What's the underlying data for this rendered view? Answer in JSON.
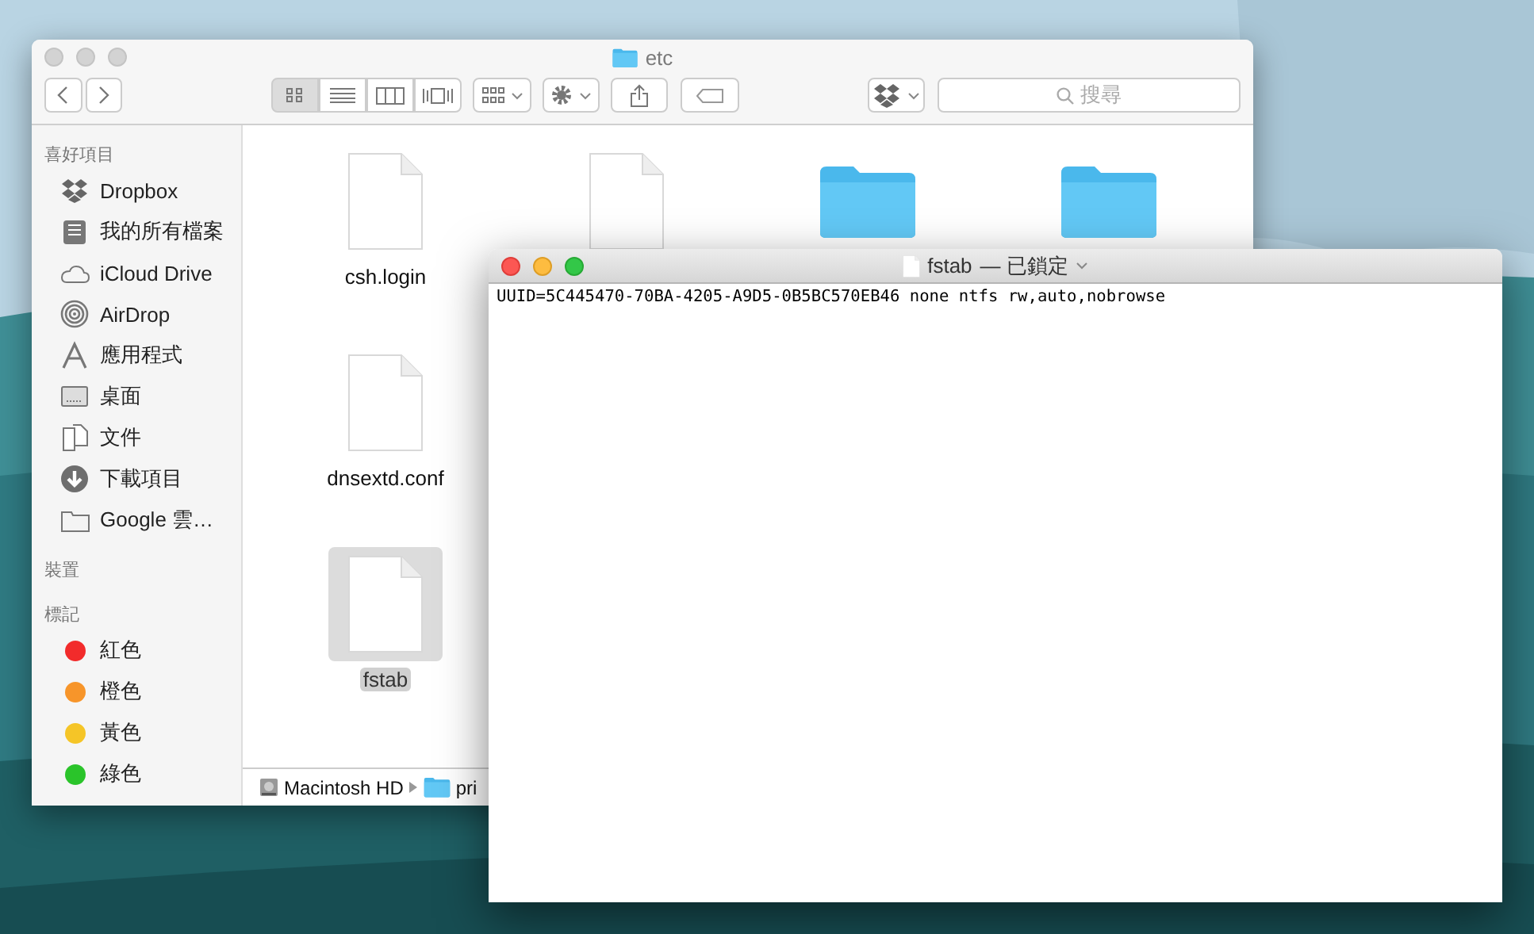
{
  "finder": {
    "title": "etc",
    "view_modes": [
      {
        "selected": true
      },
      {
        "selected": false
      },
      {
        "selected": false
      },
      {
        "selected": false
      }
    ],
    "search": {
      "placeholder": "搜尋"
    },
    "sidebar": [
      {
        "heading": "喜好項目",
        "items": [
          {
            "kind": "dropbox",
            "label": "Dropbox"
          },
          {
            "kind": "files",
            "label": "我的所有檔案"
          },
          {
            "kind": "cloud",
            "label": "iCloud Drive"
          },
          {
            "kind": "airdrop",
            "label": "AirDrop"
          },
          {
            "kind": "apps",
            "label": "應用程式"
          },
          {
            "kind": "desktop",
            "label": "桌面"
          },
          {
            "kind": "documents",
            "label": "文件"
          },
          {
            "kind": "downloads",
            "label": "下載項目"
          },
          {
            "kind": "folder",
            "label": "Google 雲…"
          }
        ]
      },
      {
        "heading": "裝置"
      },
      {
        "heading": "標記",
        "items": [
          {
            "kind": "tag",
            "label": "紅色",
            "color": "#f22b2b"
          },
          {
            "kind": "tag",
            "label": "橙色",
            "color": "#f7952a"
          },
          {
            "kind": "tag",
            "label": "黃色",
            "color": "#f5c527"
          },
          {
            "kind": "tag",
            "label": "綠色",
            "color": "#2ac42a"
          }
        ]
      }
    ],
    "files": [
      {
        "kind": "document",
        "label": "csh.login",
        "selected": false
      },
      {
        "kind": "document"
      },
      {
        "kind": "folder"
      },
      {
        "kind": "folder"
      },
      {
        "kind": "document",
        "label": "dnsextd.conf",
        "selected": false
      },
      {
        "kind": "blank"
      },
      {
        "kind": "blank"
      },
      {
        "kind": "blank"
      },
      {
        "kind": "document",
        "label": "fstab",
        "selected": true
      }
    ],
    "path_bar": [
      {
        "kind": "disk",
        "label": "Macintosh HD"
      },
      {
        "kind": "folder",
        "label": "pri"
      }
    ]
  },
  "editor": {
    "title": "fstab",
    "status": "— 已鎖定",
    "text": "UUID=5C445470-70BA-4205-A9D5-0B5BC570EB46 none ntfs rw,auto,nobrowse"
  }
}
